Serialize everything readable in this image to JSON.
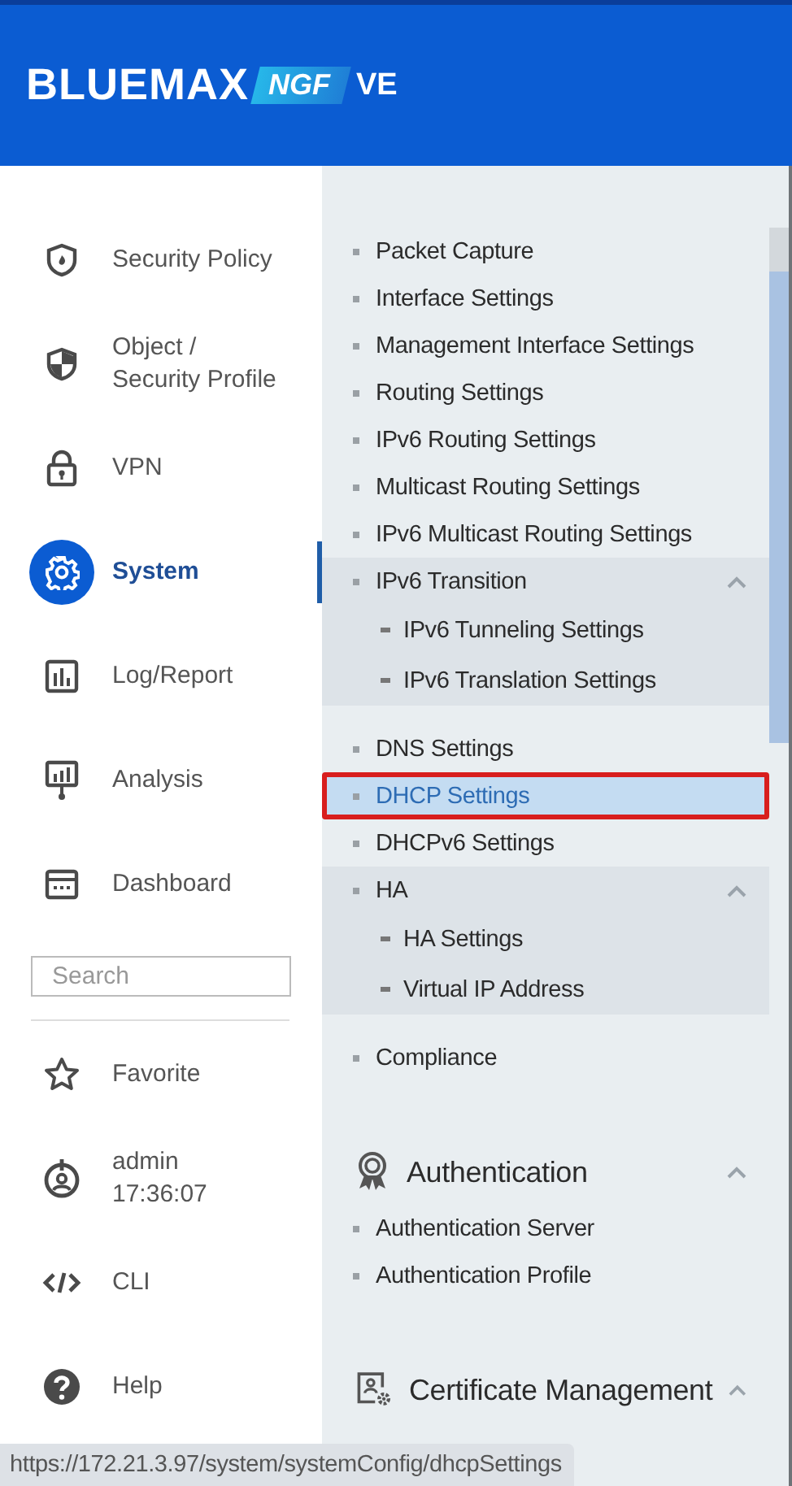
{
  "header": {
    "brand": "BLUEMAX",
    "edition": "NGF",
    "suffix": "VE"
  },
  "nav": {
    "items": [
      {
        "label": "Security Policy",
        "selected": false
      },
      {
        "label": "Object / Security Profile",
        "selected": false
      },
      {
        "label": "VPN",
        "selected": false
      },
      {
        "label": "System",
        "selected": true
      },
      {
        "label": "Log/Report",
        "selected": false
      },
      {
        "label": "Analysis",
        "selected": false
      },
      {
        "label": "Dashboard",
        "selected": false
      }
    ],
    "search": {
      "placeholder": "Search"
    },
    "bottom_items": [
      {
        "label": "Favorite"
      },
      {
        "label": "admin",
        "time": "17:36:07"
      },
      {
        "label": "CLI"
      },
      {
        "label": "Help"
      }
    ]
  },
  "menu": {
    "items": [
      {
        "kind": "item",
        "label": "Packet Capture",
        "selected": false
      },
      {
        "kind": "item",
        "label": "Interface Settings",
        "selected": false
      },
      {
        "kind": "item",
        "label": "Management Interface Settings",
        "selected": false
      },
      {
        "kind": "item",
        "label": "Routing Settings",
        "selected": false
      },
      {
        "kind": "item",
        "label": "IPv6 Routing Settings",
        "selected": false
      },
      {
        "kind": "item",
        "label": "Multicast Routing Settings",
        "selected": false
      },
      {
        "kind": "item",
        "label": "IPv6 Multicast Routing Settings",
        "selected": false
      },
      {
        "kind": "group",
        "label": "IPv6 Transition",
        "expanded": true,
        "children": [
          {
            "label": "IPv6 Tunneling Settings",
            "selected": false
          },
          {
            "label": "IPv6 Translation Settings",
            "selected": false
          }
        ]
      },
      {
        "kind": "item",
        "label": "DNS Settings",
        "selected": false
      },
      {
        "kind": "item",
        "label": "DHCP Settings",
        "selected": true,
        "highlighted": true
      },
      {
        "kind": "item",
        "label": "DHCPv6 Settings",
        "selected": false
      },
      {
        "kind": "group",
        "label": "HA",
        "expanded": true,
        "children": [
          {
            "label": "HA Settings",
            "selected": false
          },
          {
            "label": "Virtual IP Address",
            "selected": false
          }
        ]
      },
      {
        "kind": "item",
        "label": "Compliance",
        "selected": false
      }
    ],
    "sections": [
      {
        "title": "Authentication",
        "expanded": true,
        "items": [
          {
            "label": "Authentication Server",
            "selected": false
          },
          {
            "label": "Authentication Profile",
            "selected": false
          }
        ]
      },
      {
        "title": "Certificate Management",
        "expanded": true
      }
    ]
  },
  "status_bar": {
    "url": "https://172.21.3.97/system/systemConfig/dhcpSettings"
  }
}
